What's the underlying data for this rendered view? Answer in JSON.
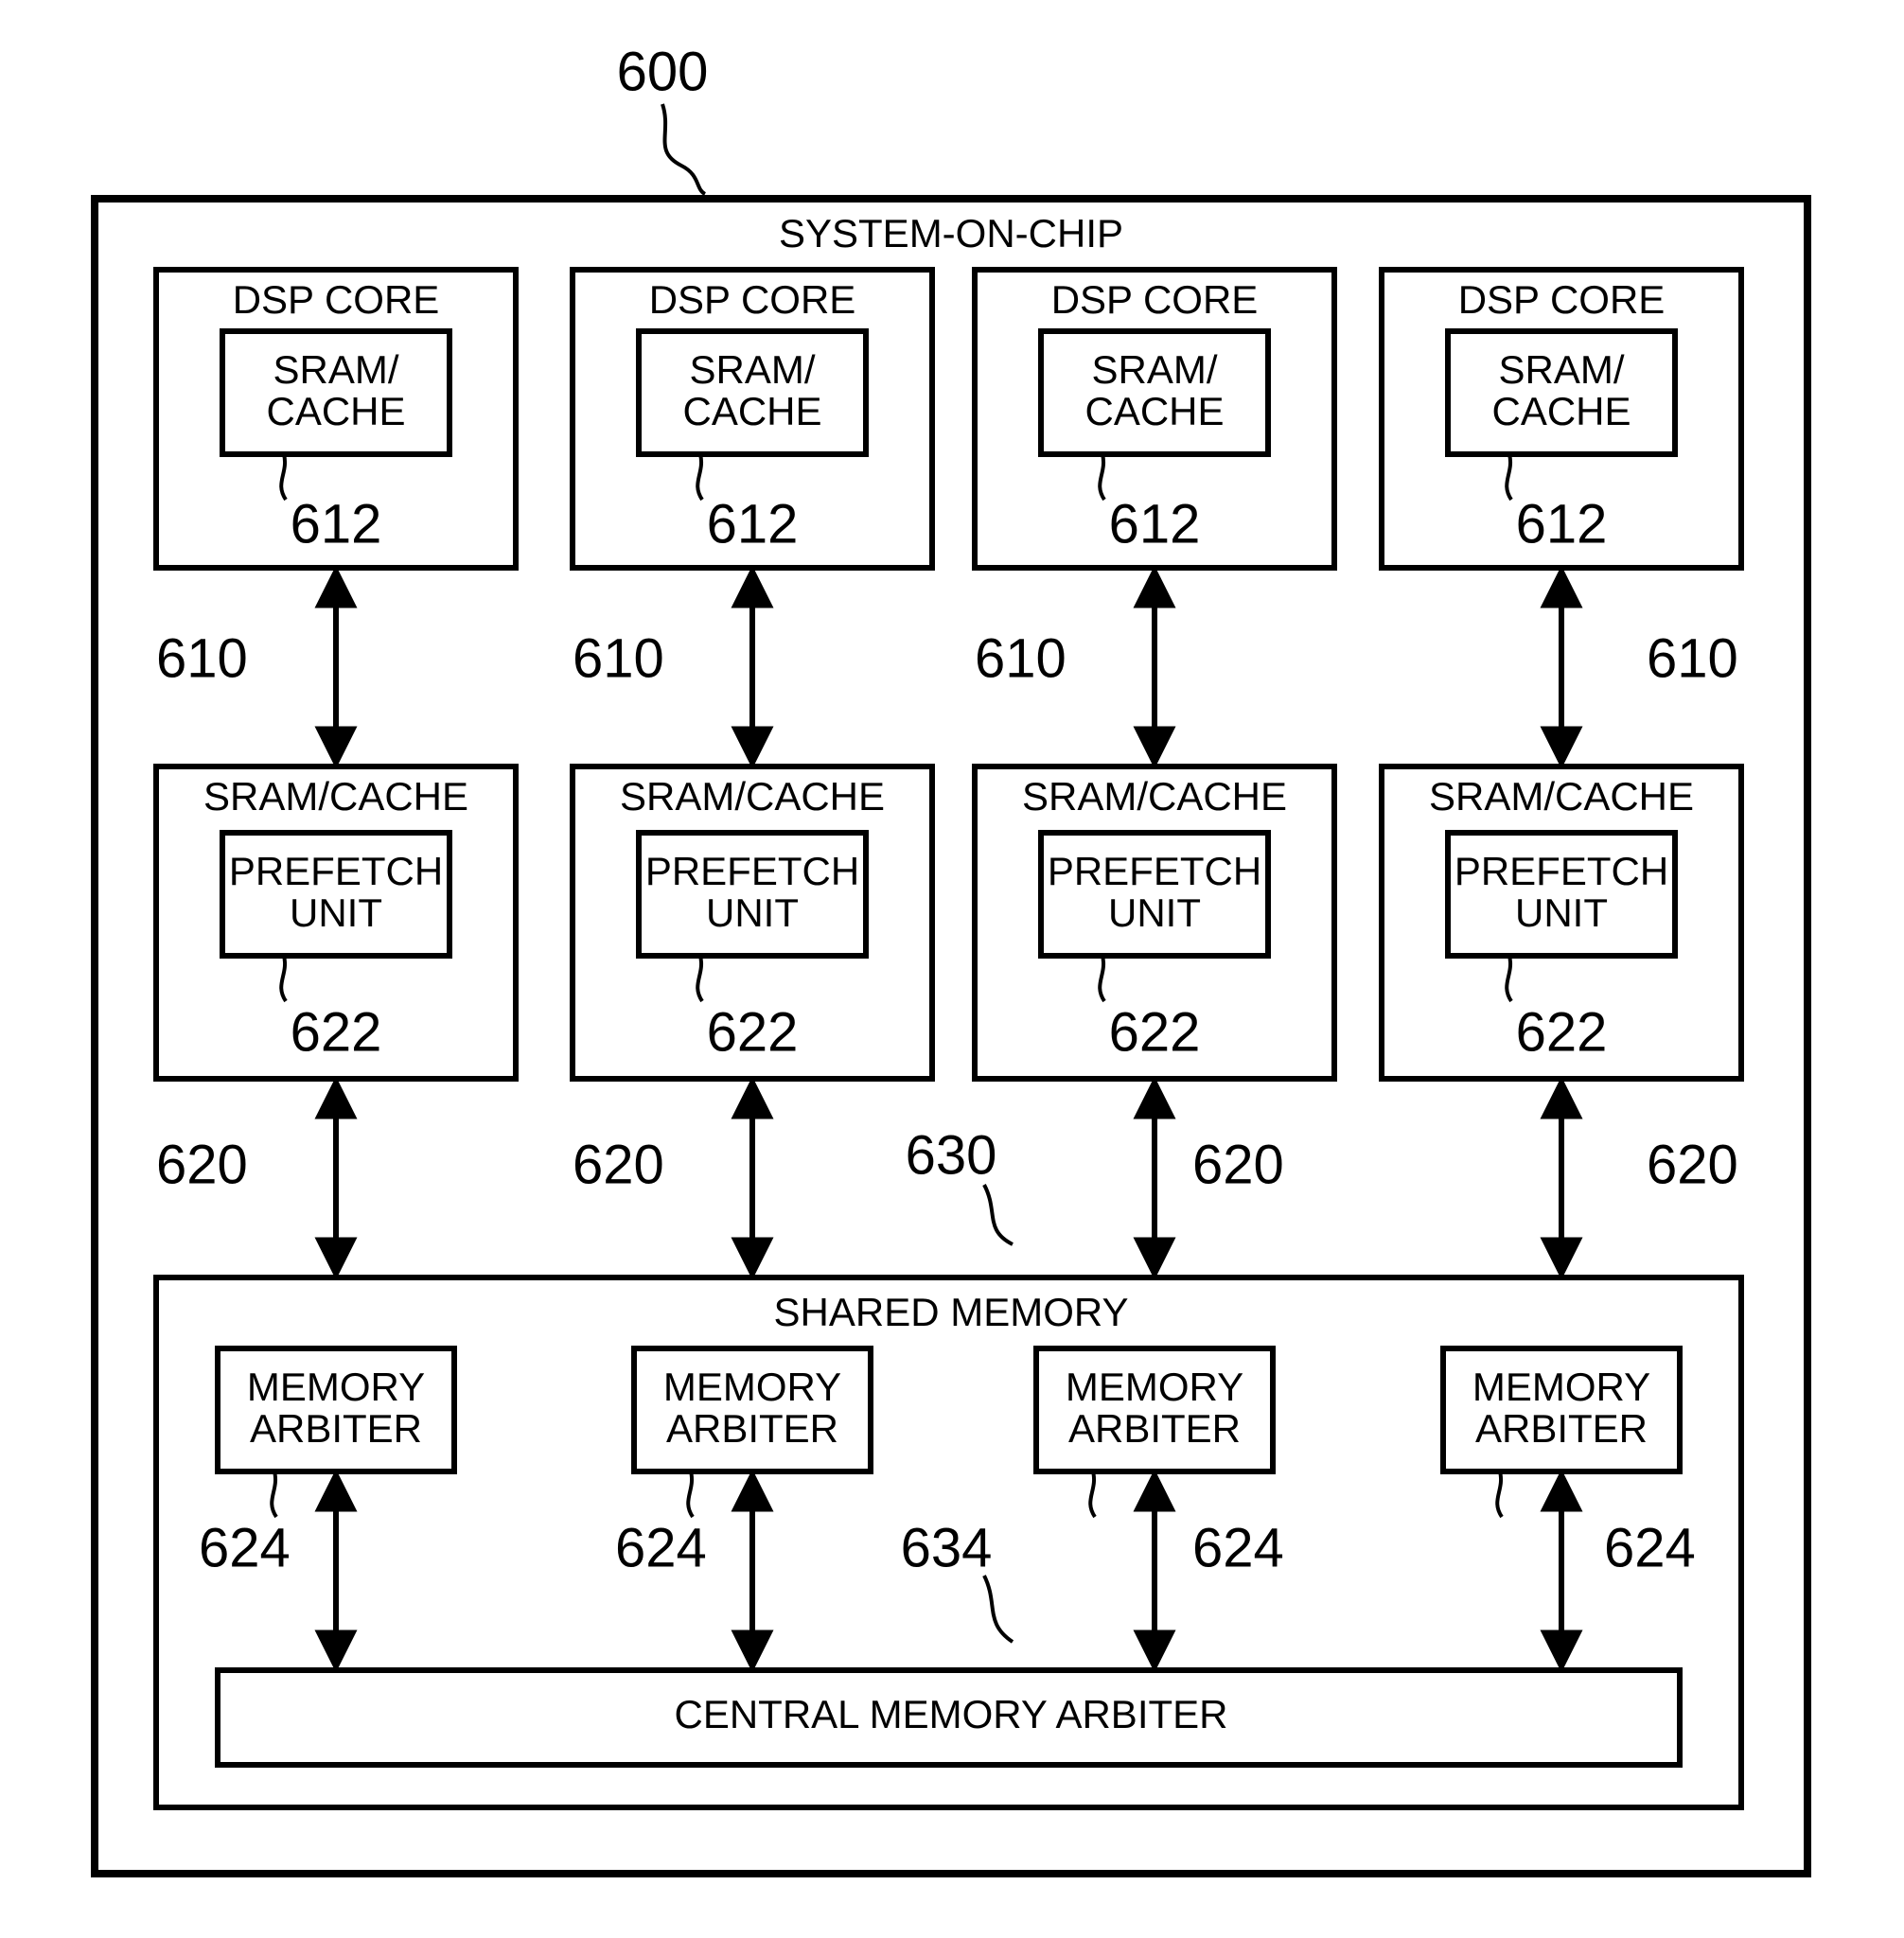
{
  "fig_ref": "600",
  "soc": {
    "title": "SYSTEM-ON-CHIP",
    "cores": [
      {
        "title": "DSP CORE",
        "inner": "SRAM/\nCACHE",
        "inner_ref": "612",
        "outer_ref": "610"
      },
      {
        "title": "DSP CORE",
        "inner": "SRAM/\nCACHE",
        "inner_ref": "612",
        "outer_ref": "610"
      },
      {
        "title": "DSP CORE",
        "inner": "SRAM/\nCACHE",
        "inner_ref": "612",
        "outer_ref": "610"
      },
      {
        "title": "DSP CORE",
        "inner": "SRAM/\nCACHE",
        "inner_ref": "612",
        "outer_ref": "610"
      }
    ],
    "sram_units": [
      {
        "title": "SRAM/CACHE",
        "inner": "PREFETCH\nUNIT",
        "inner_ref": "622",
        "outer_ref": "620"
      },
      {
        "title": "SRAM/CACHE",
        "inner": "PREFETCH\nUNIT",
        "inner_ref": "622",
        "outer_ref": "620"
      },
      {
        "title": "SRAM/CACHE",
        "inner": "PREFETCH\nUNIT",
        "inner_ref": "622",
        "outer_ref": "620"
      },
      {
        "title": "SRAM/CACHE",
        "inner": "PREFETCH\nUNIT",
        "inner_ref": "622",
        "outer_ref": "620"
      }
    ],
    "shared": {
      "title": "SHARED MEMORY",
      "ref": "630",
      "arbiters": [
        {
          "label": "MEMORY\nARBITER",
          "ref": "624"
        },
        {
          "label": "MEMORY\nARBITER",
          "ref": "624"
        },
        {
          "label": "MEMORY\nARBITER",
          "ref": "624"
        },
        {
          "label": "MEMORY\nARBITER",
          "ref": "624"
        }
      ],
      "central": {
        "label": "CENTRAL MEMORY ARBITER",
        "ref": "634"
      }
    }
  }
}
